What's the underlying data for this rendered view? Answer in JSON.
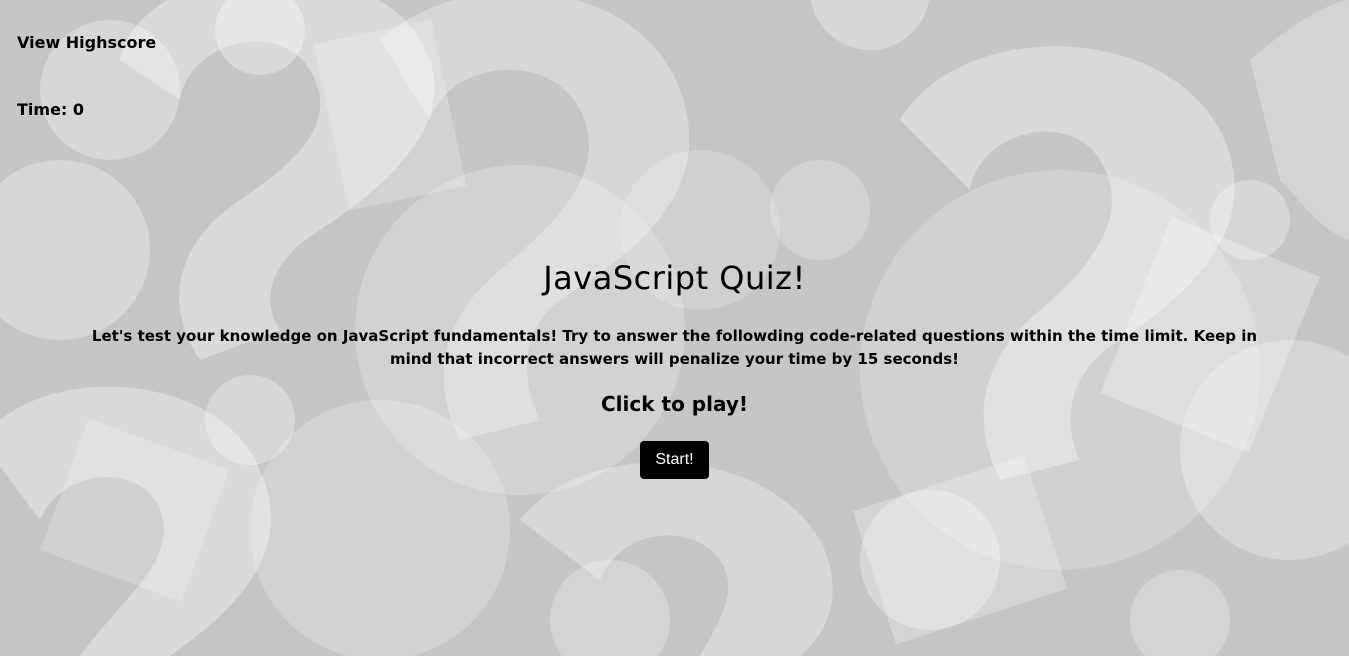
{
  "header": {
    "highscore_link": "View Highscore",
    "timer_label": "Time: ",
    "timer_value": "0"
  },
  "main": {
    "title": "JavaScript Quiz!",
    "intro": "Let's test your knowledge on JavaScript fundamentals! Try to answer the followding code-related questions within the time limit. Keep in mind that incorrect answers will penalize your time by 15 seconds!",
    "cta": "Click to play!",
    "start_button": "Start!"
  },
  "colors": {
    "background": "#c6c6c6",
    "shapes_light": "#ececec",
    "button": "#000000",
    "button_text": "#ffffff"
  }
}
